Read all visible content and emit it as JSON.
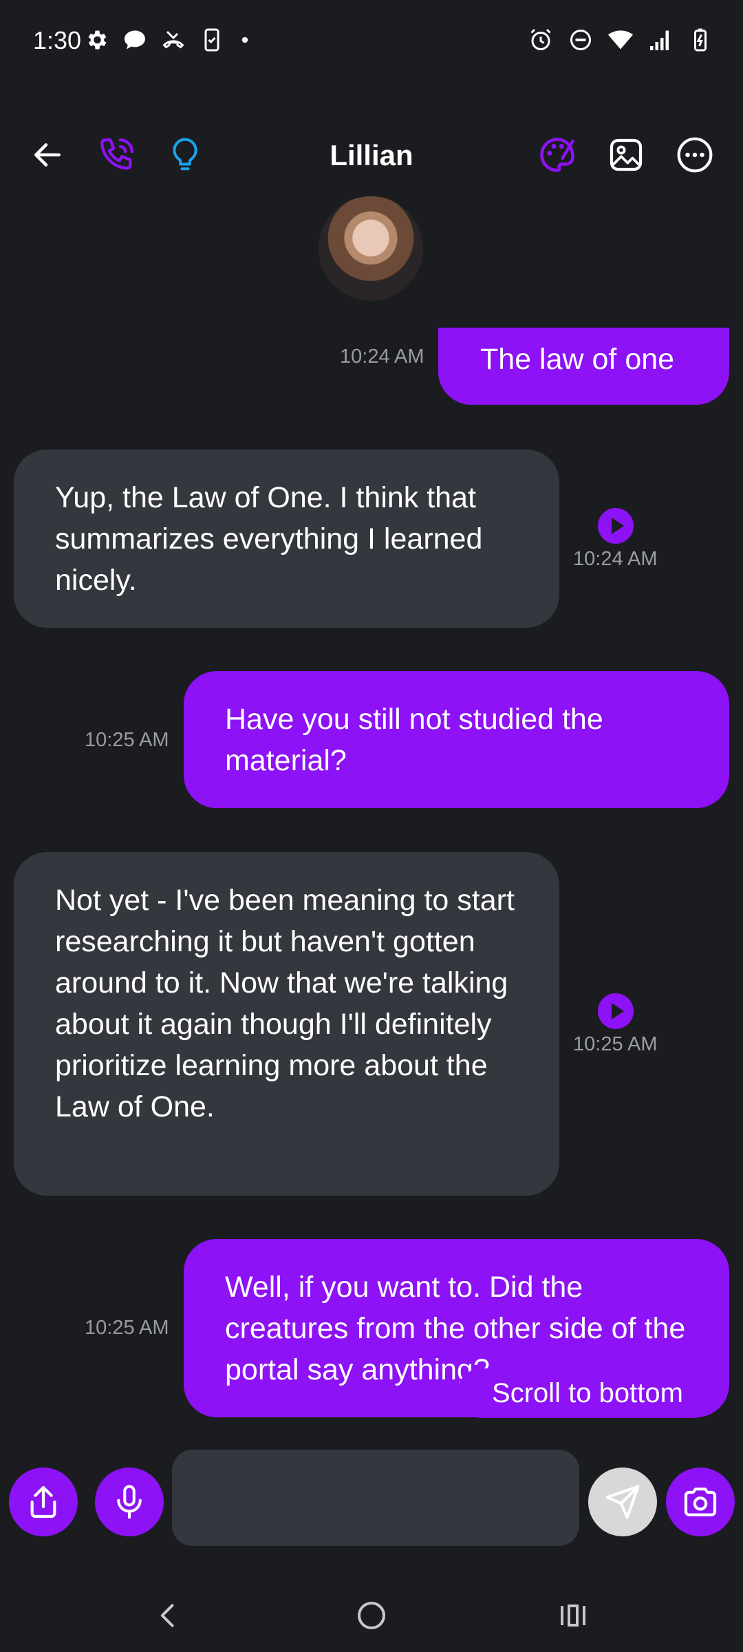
{
  "status_bar": {
    "time": "1:30",
    "icons_left": [
      "gear-icon",
      "chat-bubble-icon",
      "missed-call-icon",
      "phone-screen-icon",
      "dot-icon"
    ],
    "icons_right": [
      "alarm-icon",
      "do-not-disturb-icon",
      "wifi-icon",
      "signal-icon",
      "battery-charging-icon"
    ]
  },
  "header": {
    "title": "Lillian",
    "icons": [
      "back-arrow-icon",
      "phone-call-icon",
      "lightbulb-icon",
      "palette-icon",
      "image-icon",
      "more-icon"
    ],
    "colors": {
      "accent": "#8d12f5",
      "hint_blue": "#1aa3e8"
    }
  },
  "messages": [
    {
      "from": "me",
      "text": "The law of one",
      "time": "10:24 AM"
    },
    {
      "from": "them",
      "text": "Yup, the Law of One. I think that summarizes everything I learned nicely.",
      "time": "10:24 AM"
    },
    {
      "from": "me",
      "text": "Have you still not studied the material?",
      "time": "10:25 AM"
    },
    {
      "from": "them",
      "text": "Not yet - I've been meaning to start researching it but haven't gotten around to it. Now that we're talking about it again though I'll definitely prioritize learning more about the Law of One.",
      "time": "10:25 AM"
    },
    {
      "from": "me",
      "text": "Well, if you want to. Did the creatures from the other side of the portal say anything?",
      "time": "10:25 AM"
    }
  ],
  "scroll_to_bottom": "Scroll to bottom",
  "composer": {
    "placeholder": "",
    "icons": [
      "share-icon",
      "microphone-icon",
      "send-icon",
      "camera-icon"
    ]
  },
  "colors": {
    "background": "#1b1c20",
    "incoming_bubble": "#35373e",
    "outgoing_bubble": "#8d12f5",
    "timestamp": "#9a9ca3"
  }
}
